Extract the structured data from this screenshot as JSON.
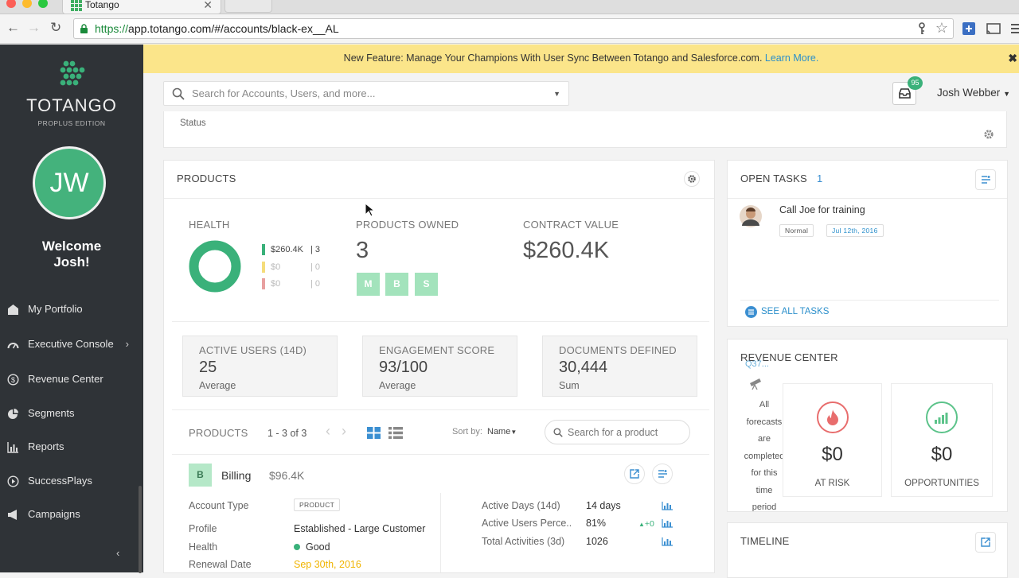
{
  "browser": {
    "tab_title": "Totango",
    "url_scheme": "https://",
    "url_rest": "app.totango.com/#/accounts/black-ex__AL"
  },
  "sidebar": {
    "logo_text": "TOTANGO",
    "logo_sub": "PROPLUS EDITION",
    "avatar_initials": "JW",
    "welcome": "Welcome Josh!",
    "items": [
      {
        "label": "My Portfolio",
        "icon": "briefcase-icon"
      },
      {
        "label": "Executive Console",
        "icon": "speedometer-icon"
      },
      {
        "label": "Revenue Center",
        "icon": "dollar-icon"
      },
      {
        "label": "Segments",
        "icon": "pie-icon"
      },
      {
        "label": "Reports",
        "icon": "bar-chart-icon"
      },
      {
        "label": "SuccessPlays",
        "icon": "play-icon"
      },
      {
        "label": "Campaigns",
        "icon": "megaphone-icon"
      }
    ]
  },
  "banner": {
    "text": "New Feature: Manage Your Champions With User Sync Between Totango and Salesforce.com.",
    "link": "Learn More.",
    "close": "✖"
  },
  "header": {
    "search_placeholder": "Search for Accounts, Users, and more...",
    "inbox_count": "95",
    "user_name": "Josh Webber"
  },
  "status_card": {
    "label": "Status"
  },
  "products_card": {
    "title": "PRODUCTS",
    "health_label": "HEALTH",
    "health_legend": [
      {
        "value": "$260.4K",
        "count": "3",
        "color": "#3ab17a"
      },
      {
        "value": "$0",
        "count": "0",
        "color": "#f5dc7a"
      },
      {
        "value": "$0",
        "count": "0",
        "color": "#e8a0a0"
      }
    ],
    "products_owned_label": "PRODUCTS OWNED",
    "products_owned_value": "3",
    "product_chips": [
      "M",
      "B",
      "S"
    ],
    "contract_value_label": "CONTRACT VALUE",
    "contract_value": "$260.4K",
    "metrics": [
      {
        "title": "ACTIVE USERS (14D)",
        "value": "25",
        "sub": "Average"
      },
      {
        "title": "ENGAGEMENT SCORE",
        "value": "93/100",
        "sub": "Average"
      },
      {
        "title": "DOCUMENTS DEFINED",
        "value": "30,444",
        "sub": "Sum"
      }
    ],
    "list_header": "PRODUCTS",
    "pager": "1 - 3 of 3",
    "sort_label": "Sort by:",
    "sort_value": "Name",
    "product_search_placeholder": "Search for a product",
    "product": {
      "chip": "B",
      "name": "Billing",
      "value": "$96.4K",
      "left_rows": [
        {
          "label": "Account Type",
          "value": "PRODUCT"
        },
        {
          "label": "Profile",
          "value": "Established - Large Customer"
        },
        {
          "label": "Health",
          "value": "Good"
        },
        {
          "label": "Renewal Date",
          "value": "Sep 30th, 2016"
        }
      ],
      "right_rows": [
        {
          "label": "Active Days (14d)",
          "value": "14 days",
          "delta": ""
        },
        {
          "label": "Active Users Perce..",
          "value": "81%",
          "delta": "+0"
        },
        {
          "label": "Total Activities (3d)",
          "value": "1026",
          "delta": ""
        }
      ]
    }
  },
  "tasks_card": {
    "title": "OPEN TASKS",
    "count": "1",
    "task_title": "Call Joe for training",
    "priority": "Normal",
    "date": "Jul 12th, 2016",
    "see_all": "SEE ALL TASKS"
  },
  "revenue_card": {
    "title": "REVENUE CENTER",
    "overlay_text": "Q37...",
    "side_text": "All forecasts are completed for this time period",
    "at_risk_value": "$0",
    "at_risk_label": "AT RISK",
    "opps_value": "$0",
    "opps_label": "OPPORTUNITIES"
  },
  "timeline_card": {
    "title": "TIMELINE"
  },
  "colors": {
    "accent_green": "#3ab17a",
    "sidebar_bg": "#2f3337",
    "banner_bg": "#fbe58a",
    "link_blue": "#2b8fcb",
    "date_orange": "#f0b400"
  }
}
